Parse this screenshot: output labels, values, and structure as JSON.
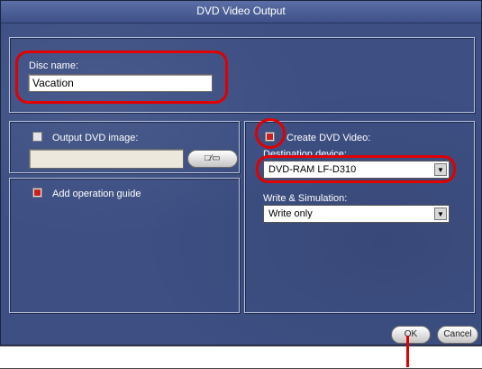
{
  "window": {
    "title": "DVD Video Output"
  },
  "disc": {
    "label": "Disc name:",
    "value": "Vacation"
  },
  "output_image": {
    "label": "Output DVD image:",
    "checked": false,
    "path": "",
    "browse_icon": "folder-file-icon"
  },
  "operation_guide": {
    "label": "Add operation guide",
    "checked": true
  },
  "create_video": {
    "label": "Create DVD Video:",
    "checked": true,
    "device_label": "Destination device:",
    "device_value": "DVD-RAM LF-D310",
    "write_label": "Write & Simulation:",
    "write_value": "Write only"
  },
  "buttons": {
    "ok": "OK",
    "cancel": "Cancel"
  },
  "colors": {
    "panel_bg": "#3d4f83",
    "highlight": "#e00000"
  }
}
